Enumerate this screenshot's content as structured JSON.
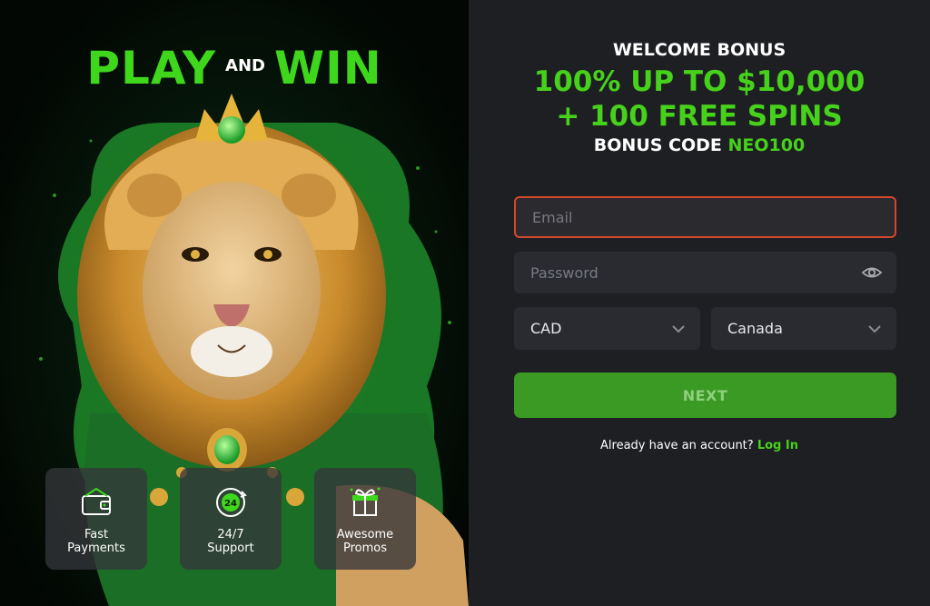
{
  "hero": {
    "play": "PLAY",
    "and": "AND",
    "win": "WIN"
  },
  "features": [
    {
      "icon": "wallet-icon",
      "label": "Fast\nPayments"
    },
    {
      "icon": "support-24-icon",
      "label": "24/7\nSupport"
    },
    {
      "icon": "gift-icon",
      "label": "Awesome\nPromos"
    }
  ],
  "bonus": {
    "title": "WELCOME BONUS",
    "line1": "100% UP TO $10,000",
    "line2": "+ 100 FREE SPINS",
    "code_label": "BONUS CODE",
    "code": "NEO100"
  },
  "form": {
    "email_placeholder": "Email",
    "password_placeholder": "Password",
    "currency": "CAD",
    "country": "Canada",
    "next_label": "NEXT",
    "login_prompt": "Already have an account?",
    "login_link": "Log In"
  },
  "colors": {
    "accent": "#46d11b",
    "error_border": "#d4482a",
    "panel_bg": "#1e1f23"
  }
}
